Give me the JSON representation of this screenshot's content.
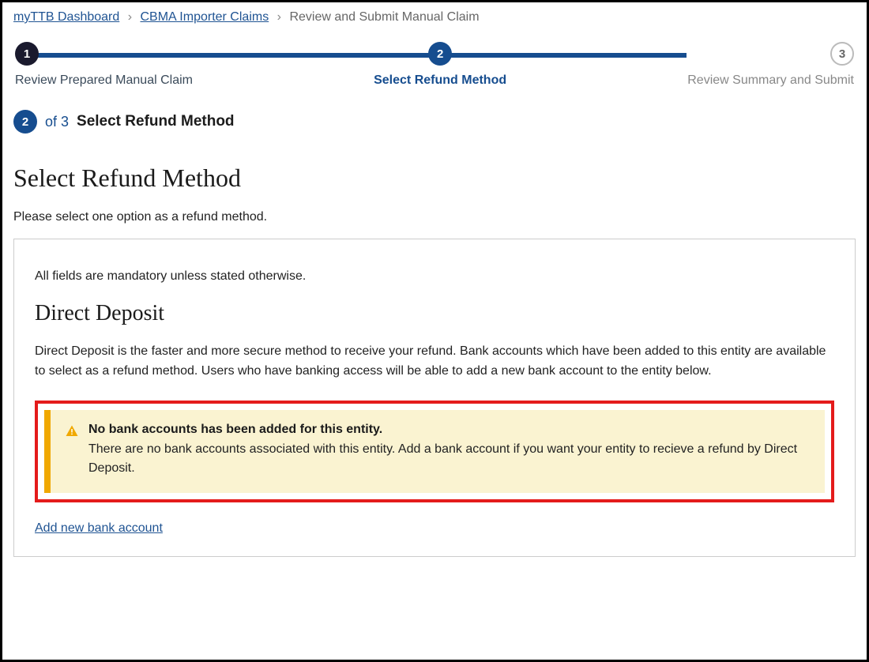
{
  "breadcrumb": {
    "items": [
      {
        "label": "myTTB Dashboard",
        "link": true
      },
      {
        "label": "CBMA Importer Claims",
        "link": true
      },
      {
        "label": "Review and Submit Manual Claim",
        "link": false
      }
    ],
    "sep": "›"
  },
  "stepper": {
    "steps": [
      {
        "num": "1",
        "label": "Review Prepared Manual Claim",
        "state": "done"
      },
      {
        "num": "2",
        "label": "Select Refund Method",
        "state": "active"
      },
      {
        "num": "3",
        "label": "Review Summary and Submit",
        "state": "upcoming"
      }
    ]
  },
  "progress": {
    "current": "2",
    "of_text": "of 3",
    "title": "Select Refund Method"
  },
  "page": {
    "heading": "Select Refund Method",
    "subtext": "Please select one option as a refund method."
  },
  "form": {
    "mandatory_note": "All fields are mandatory unless stated otherwise.",
    "section_heading": "Direct Deposit",
    "section_desc": "Direct Deposit is the faster and more secure method to receive your refund. Bank accounts which have been added to this entity are available to select as a refund method. Users who have banking access will be able to add a new bank account to the entity below.",
    "alert": {
      "title": "No bank accounts has been added for this entity.",
      "body": "There are no bank accounts associated with this entity. Add a bank account if you want your entity to recieve a refund by Direct Deposit."
    },
    "add_link": "Add new bank account"
  }
}
